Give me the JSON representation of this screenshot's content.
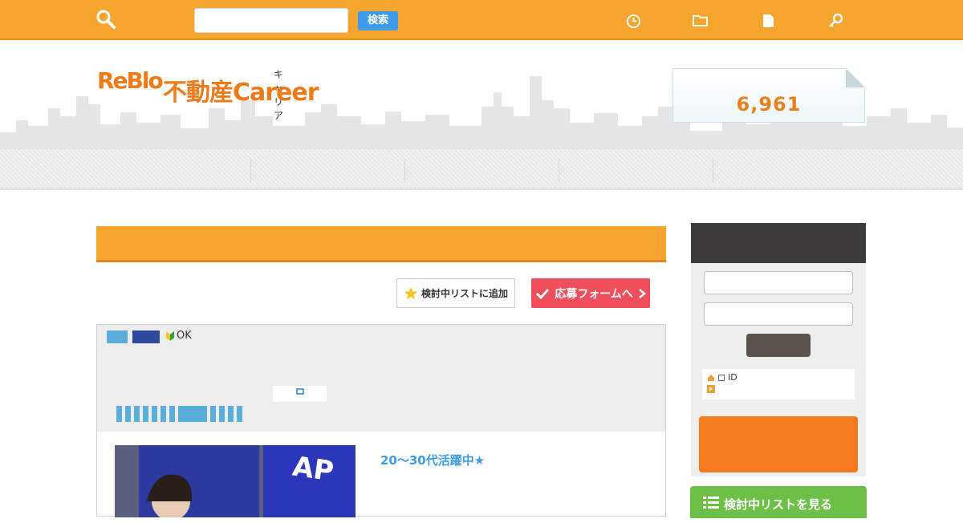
{
  "topbar": {
    "search_label": "",
    "search_placeholder": "",
    "search_button": "検索",
    "links": [
      {
        "label": "",
        "icon": "clock-icon"
      },
      {
        "label": "",
        "icon": "folder-icon"
      },
      {
        "label": "",
        "icon": "document-icon"
      },
      {
        "label": "",
        "icon": "key-icon"
      }
    ]
  },
  "header": {
    "subtitle": "",
    "logo_reblo": "ReBlo",
    "logo_kana": "キャリア",
    "logo_main": "不動産Career",
    "description": "",
    "count_label": "",
    "count_value": "6,961"
  },
  "nav": {
    "items": [
      "",
      "",
      "",
      "",
      ""
    ]
  },
  "breadcrumb": {
    "link1": "",
    "link2": "",
    "current": ""
  },
  "main": {
    "heading": "",
    "fav_button": "検討中リストに追加",
    "apply_button": "応募フォームへ"
  },
  "job": {
    "badge1": "",
    "badge2": "",
    "beginner_label": "OK",
    "title": "",
    "company": "",
    "company_link": "",
    "tags": [
      "",
      "",
      "",
      "",
      "",
      "",
      "",
      "",
      "",
      "",
      "",
      ""
    ],
    "catch": "20〜30代活躍中★",
    "catch_sub": ""
  },
  "sidebar": {
    "login_title": "",
    "login_subtitle": "",
    "save_id_label": "ID",
    "forgot_link": "",
    "register_button": "",
    "list_button": "検討中リストを見る"
  },
  "colors": {
    "brand_orange": "#f6a52e",
    "logo_orange": "#f07a18",
    "accent_blue": "#3d9be9",
    "apply_red": "#ef4f5b",
    "sidebar_dark": "#3d3a38",
    "list_green": "#6cc045"
  }
}
